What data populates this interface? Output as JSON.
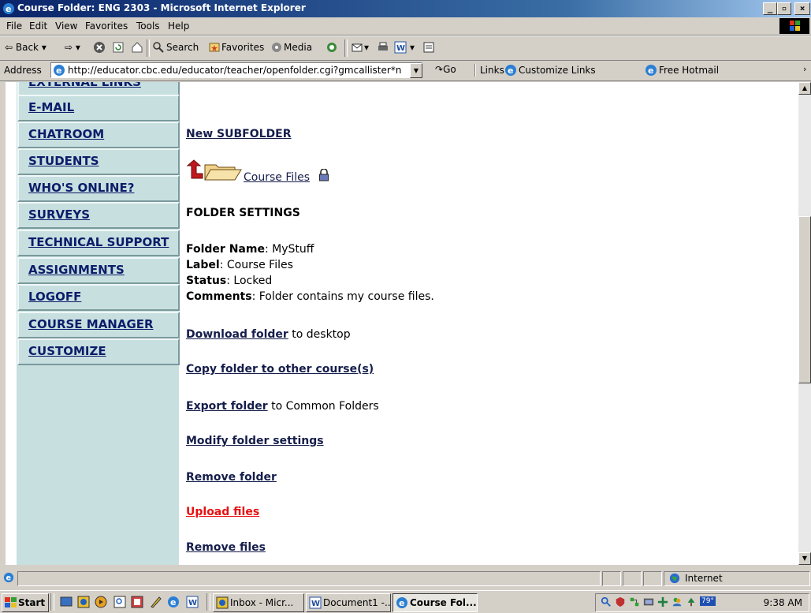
{
  "window": {
    "title": "Course Folder: ENG 2303 - Microsoft Internet Explorer",
    "minimize": "_",
    "maximize": "8",
    "close": "×"
  },
  "menu": [
    "File",
    "Edit",
    "View",
    "Favorites",
    "Tools",
    "Help"
  ],
  "toolbar": {
    "back": "Back",
    "search": "Search",
    "favorites": "Favorites",
    "media": "Media"
  },
  "address": {
    "label": "Address",
    "url": "http://educator.cbc.edu/educator/teacher/openfolder.cgi?gmcallister*n",
    "go": "Go",
    "links": "Links",
    "customize_links": "Customize Links",
    "free_hotmail": "Free Hotmail"
  },
  "sidebar": {
    "partial_item": "EXTERNAL LINKS",
    "items": [
      "E-MAIL",
      "CHATROOM",
      "STUDENTS",
      "WHO'S ONLINE?",
      "SURVEYS",
      "TECHNICAL SUPPORT",
      "ASSIGNMENTS",
      "LOGOFF",
      "COURSE MANAGER",
      "CUSTOMIZE"
    ]
  },
  "content": {
    "new_subfolder": "New SUBFOLDER",
    "folder_link": "Course Files",
    "settings_heading": "FOLDER SETTINGS",
    "folder_name_label": "Folder Name",
    "folder_name_value": ": MyStuff",
    "label_label": "Label",
    "label_value": ": Course Files",
    "status_label": "Status",
    "status_value": ": Locked",
    "comments_label": "Comments",
    "comments_value": ": Folder contains my course files.",
    "download_folder": "Download folder",
    "download_suffix": " to desktop",
    "copy_folder": "Copy folder to other course(s)",
    "export_folder": "Export folder",
    "export_suffix": " to Common Folders",
    "modify_folder": "Modify folder settings",
    "remove_folder": "Remove folder",
    "upload_files": "Upload files",
    "remove_files": "Remove files",
    "upload_color": "#e81010"
  },
  "statusbar": {
    "zone": "Internet"
  },
  "taskbar": {
    "start": "Start",
    "tasks": [
      "Inbox - Micr...",
      "Document1 -...",
      "Course Fol..."
    ],
    "temp": "79°",
    "clock": "9:38 AM"
  }
}
